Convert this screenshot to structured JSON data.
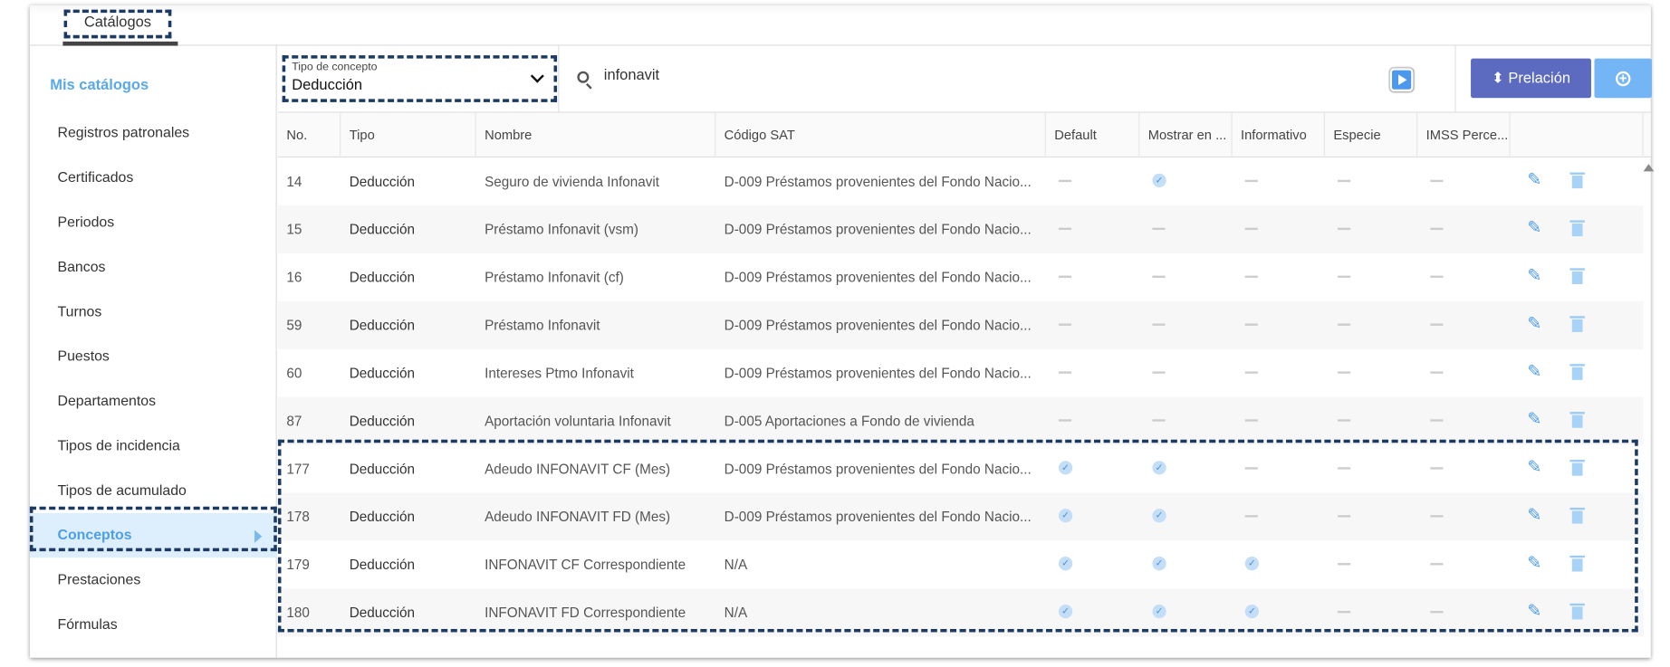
{
  "tabs": [
    {
      "label": "Catálogos",
      "active": true
    }
  ],
  "sidebar": {
    "title": "Mis catálogos",
    "items": [
      {
        "label": "Registros patronales"
      },
      {
        "label": "Certificados"
      },
      {
        "label": "Periodos"
      },
      {
        "label": "Bancos"
      },
      {
        "label": "Turnos"
      },
      {
        "label": "Puestos"
      },
      {
        "label": "Departamentos"
      },
      {
        "label": "Tipos de incidencia"
      },
      {
        "label": "Tipos de acumulado"
      },
      {
        "label": "Conceptos",
        "active": true
      },
      {
        "label": "Prestaciones"
      },
      {
        "label": "Fórmulas"
      }
    ]
  },
  "toolbar": {
    "select_label": "Tipo de concepto",
    "select_value": "Deducción",
    "search_value": "infonavit",
    "prelacion_label": "Prelación",
    "add_label": "+"
  },
  "table": {
    "columns": [
      "No.",
      "Tipo",
      "Nombre",
      "Código SAT",
      "Default",
      "Mostrar en ...",
      "Informativo",
      "Especie",
      "IMSS Perce..."
    ],
    "rows": [
      {
        "no": "14",
        "tipo": "Deducción",
        "nombre": "Seguro de vivienda Infonavit",
        "sat": "D-009 Préstamos provenientes del Fondo Nacio...",
        "flags": [
          false,
          true,
          false,
          false,
          false
        ]
      },
      {
        "no": "15",
        "tipo": "Deducción",
        "nombre": "Préstamo Infonavit (vsm)",
        "sat": "D-009 Préstamos provenientes del Fondo Nacio...",
        "flags": [
          false,
          false,
          false,
          false,
          false
        ]
      },
      {
        "no": "16",
        "tipo": "Deducción",
        "nombre": "Préstamo Infonavit (cf)",
        "sat": "D-009 Préstamos provenientes del Fondo Nacio...",
        "flags": [
          false,
          false,
          false,
          false,
          false
        ]
      },
      {
        "no": "59",
        "tipo": "Deducción",
        "nombre": "Préstamo Infonavit",
        "sat": "D-009 Préstamos provenientes del Fondo Nacio...",
        "flags": [
          false,
          false,
          false,
          false,
          false
        ]
      },
      {
        "no": "60",
        "tipo": "Deducción",
        "nombre": "Intereses Ptmo Infonavit",
        "sat": "D-009 Préstamos provenientes del Fondo Nacio...",
        "flags": [
          false,
          false,
          false,
          false,
          false
        ]
      },
      {
        "no": "87",
        "tipo": "Deducción",
        "nombre": "Aportación voluntaria Infonavit",
        "sat": "D-005 Aportaciones a Fondo de vivienda",
        "flags": [
          false,
          false,
          false,
          false,
          false
        ]
      },
      {
        "no": "177",
        "tipo": "Deducción",
        "nombre": "Adeudo INFONAVIT CF (Mes)",
        "sat": "D-009 Préstamos provenientes del Fondo Nacio...",
        "flags": [
          true,
          true,
          false,
          false,
          false
        ]
      },
      {
        "no": "178",
        "tipo": "Deducción",
        "nombre": "Adeudo INFONAVIT FD (Mes)",
        "sat": "D-009 Préstamos provenientes del Fondo Nacio...",
        "flags": [
          true,
          true,
          false,
          false,
          false
        ]
      },
      {
        "no": "179",
        "tipo": "Deducción",
        "nombre": "INFONAVIT CF Correspondiente",
        "sat": "N/A",
        "flags": [
          true,
          true,
          true,
          false,
          false
        ]
      },
      {
        "no": "180",
        "tipo": "Deducción",
        "nombre": "INFONAVIT FD Correspondiente",
        "sat": "N/A",
        "flags": [
          true,
          true,
          true,
          false,
          false
        ]
      }
    ]
  },
  "colors": {
    "accent": "#5aa8e6",
    "prelacion": "#5c6bc0",
    "add": "#74b5f5",
    "highlight": "#1b3a66"
  }
}
